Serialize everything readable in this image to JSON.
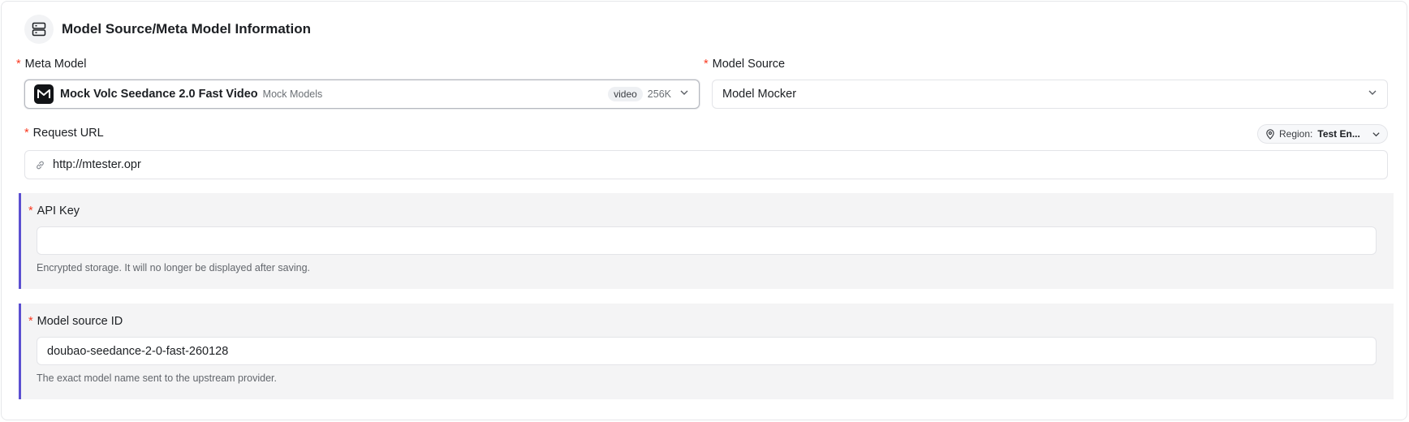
{
  "header": {
    "icon": "server-icon",
    "title": "Model Source/Meta Model Information"
  },
  "meta_model": {
    "label": "Meta Model",
    "required": "*",
    "selected_name": "Mock Volc Seedance 2.0 Fast Video",
    "vendor": "Mock Models",
    "tag": "video",
    "context": "256K"
  },
  "model_source": {
    "label": "Model Source",
    "required": "*",
    "selected": "Model Mocker"
  },
  "request_url": {
    "label": "Request URL",
    "required": "*",
    "value": "http://mtester.opr",
    "region_label": "Region:",
    "region_value": "Test En..."
  },
  "api_key": {
    "label": "API Key",
    "required": "*",
    "value": "",
    "hint": "Encrypted storage. It will no longer be displayed after saving."
  },
  "model_source_id": {
    "label": "Model source ID",
    "required": "*",
    "value": "doubao-seedance-2-0-fast-260128",
    "hint": "The exact model name sent to the upstream provider."
  },
  "colors": {
    "accent": "#5b4fd1",
    "required": "#f93920",
    "section_bg": "#f4f4f5"
  }
}
